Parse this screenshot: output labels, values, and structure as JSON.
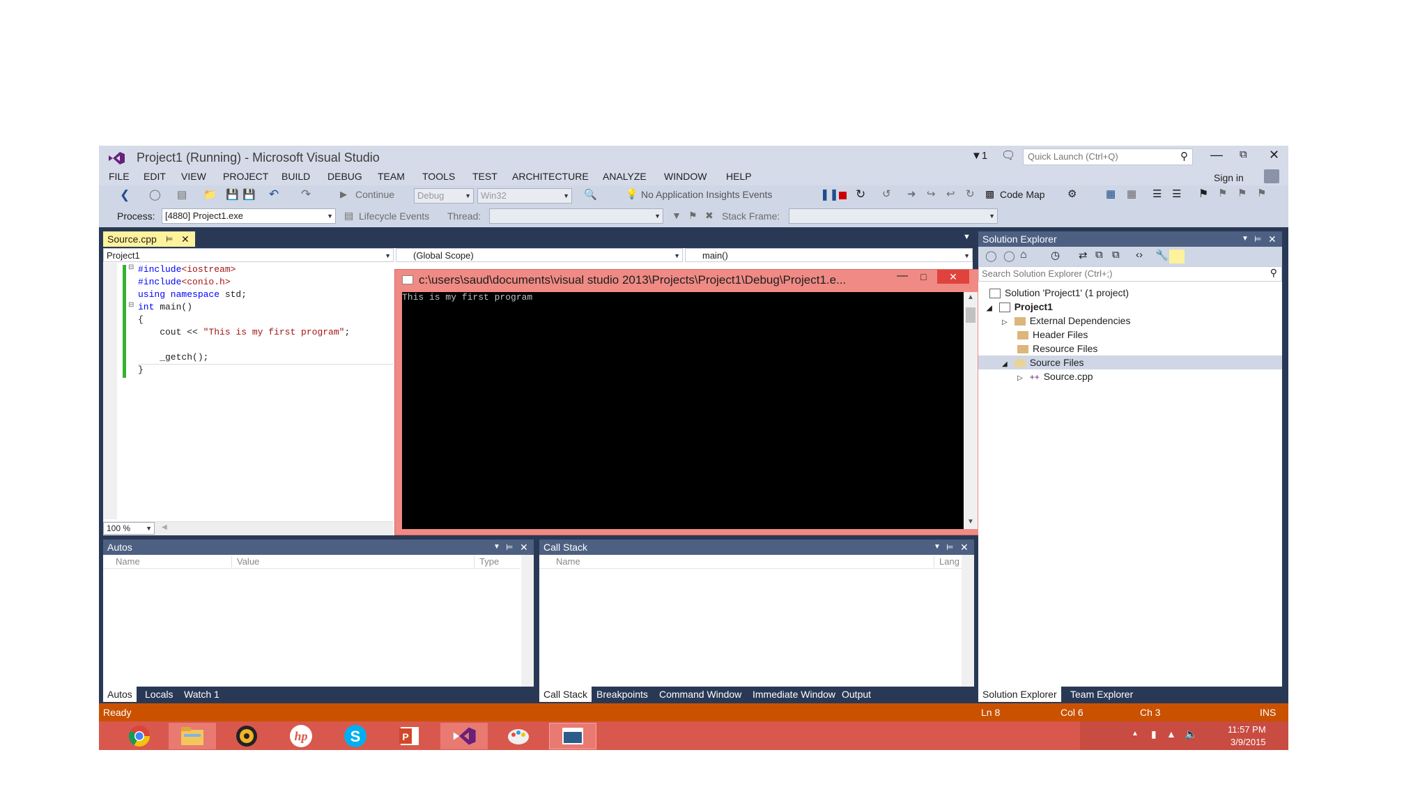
{
  "window": {
    "title": "Project1 (Running) - Microsoft Visual Studio",
    "notif_count": "1",
    "quick_launch_placeholder": "Quick Launch (Ctrl+Q)",
    "sign_in": "Sign in"
  },
  "menu": [
    "FILE",
    "EDIT",
    "VIEW",
    "PROJECT",
    "BUILD",
    "DEBUG",
    "TEAM",
    "TOOLS",
    "TEST",
    "ARCHITECTURE",
    "ANALYZE",
    "WINDOW",
    "HELP"
  ],
  "toolbar": {
    "continue": "Continue",
    "config": "Debug",
    "platform": "Win32",
    "insights": "No Application Insights Events",
    "code_map": "Code Map"
  },
  "debugbar": {
    "process_label": "Process:",
    "process_value": "[4880] Project1.exe",
    "lifecycle": "Lifecycle Events",
    "thread_label": "Thread:",
    "stack_label": "Stack Frame:"
  },
  "editor": {
    "tab": "Source.cpp",
    "project_combo": "Project1",
    "scope_combo": "(Global Scope)",
    "func_combo": "main()",
    "zoom": "100 %",
    "lines": [
      {
        "a": "#include",
        "b": "<iostream>"
      },
      {
        "a": "#include",
        "b": "<conio.h>"
      },
      {
        "a": "using namespace",
        "b": " std;"
      },
      {
        "a": "int",
        "b": " main()"
      },
      {
        "a": "{",
        "b": ""
      },
      {
        "a": "    cout << ",
        "b": "\"This is my first program\"",
        "c": ";"
      },
      {
        "a": "",
        "b": ""
      },
      {
        "a": "    _getch();",
        "b": ""
      },
      {
        "a": "}",
        "b": ""
      }
    ]
  },
  "console": {
    "title": "c:\\users\\saud\\documents\\visual studio 2013\\Projects\\Project1\\Debug\\Project1.e...",
    "output": "This is my first program"
  },
  "solution_explorer": {
    "title": "Solution Explorer",
    "search_placeholder": "Search Solution Explorer (Ctrl+;)",
    "items": [
      {
        "label": "Solution 'Project1' (1 project)"
      },
      {
        "label": "Project1"
      },
      {
        "label": "External Dependencies"
      },
      {
        "label": "Header Files"
      },
      {
        "label": "Resource Files"
      },
      {
        "label": "Source Files"
      },
      {
        "label": "Source.cpp"
      }
    ],
    "tabs": [
      "Solution Explorer",
      "Team Explorer"
    ]
  },
  "autos": {
    "title": "Autos",
    "columns": [
      "Name",
      "Value",
      "Type"
    ],
    "tabs": [
      "Autos",
      "Locals",
      "Watch 1"
    ]
  },
  "callstack": {
    "title": "Call Stack",
    "columns": [
      "Name",
      "Lang"
    ],
    "tabs": [
      "Call Stack",
      "Breakpoints",
      "Command Window",
      "Immediate Window",
      "Output"
    ]
  },
  "status": {
    "ready": "Ready",
    "ln": "Ln 8",
    "col": "Col 6",
    "ch": "Ch 3",
    "ins": "INS"
  },
  "taskbar": {
    "apps": [
      "chrome-icon",
      "file-explorer-icon",
      "media-player-icon",
      "hp-icon",
      "skype-icon",
      "powerpoint-icon",
      "visual-studio-icon",
      "paint-icon",
      "console-icon"
    ],
    "time": "11:57 PM",
    "date": "3/9/2015"
  },
  "colors": {
    "accent": "#ca5100",
    "console_frame": "#f08080",
    "tool_header": "#4d6082"
  }
}
